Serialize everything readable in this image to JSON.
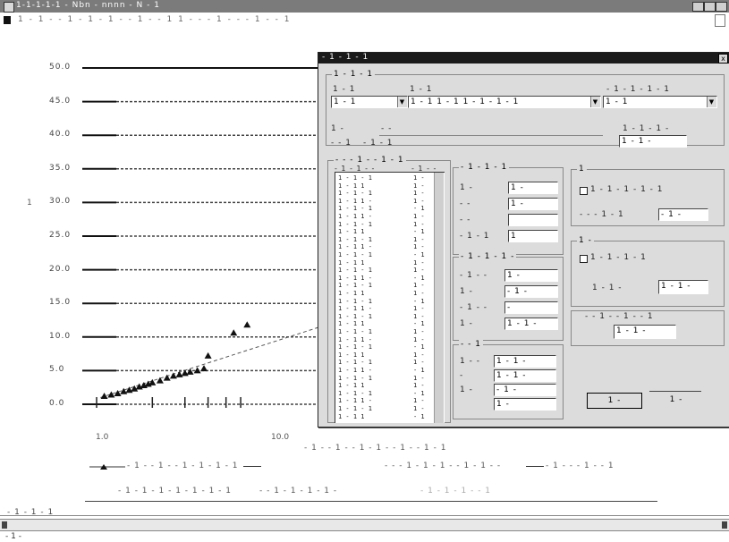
{
  "window": {
    "title": "1-1-1-1-1 - Nbn - nnnn - N - 1",
    "menu_text": "1 - 1 - - 1 - 1 - 1 - - 1 - - 1 1 - - - 1 - - - 1 - - 1",
    "controls": [
      "_",
      "□",
      "x"
    ]
  },
  "chart": {
    "y_ticks": [
      "50.0",
      "45.0",
      "40.0",
      "35.0",
      "30.0",
      "25.0",
      "20.0",
      "15.0",
      "10.0",
      "5.0",
      "0.0"
    ],
    "x_ticks": [
      "1.0",
      "10.0"
    ],
    "ylabel": "1",
    "xlabel": "- 1 - - 1 - - 1 - 1 - - 1 - - 1 - 1",
    "legend": [
      {
        "label": "- 1 - - 1 - - 1 - 1 - 1 - 1",
        "style": "marker-line"
      },
      {
        "label": "- - - 1 - 1 - 1 - - 1 - 1 - -",
        "style": "solid"
      },
      {
        "label": "- 1 - - - 1 - - 1",
        "style": "line"
      }
    ],
    "legend_row2": [
      "- 1 - 1 - 1 - 1 - 1 - 1 - 1",
      "- - 1 - 1 - 1 - 1 -",
      "- 1 - 1 - 1 - - 1"
    ]
  },
  "chart_data": {
    "type": "scatter",
    "x_axis": "log",
    "ylim": [
      0,
      50
    ],
    "y_ticks": [
      0,
      5,
      10,
      15,
      20,
      25,
      30,
      35,
      40,
      45,
      50
    ],
    "series": [
      {
        "style": "markers",
        "points": [
          [
            1.1,
            1.2
          ],
          [
            1.2,
            1.4
          ],
          [
            1.3,
            1.6
          ],
          [
            1.4,
            1.9
          ],
          [
            1.5,
            2.1
          ],
          [
            1.6,
            2.3
          ],
          [
            1.7,
            2.6
          ],
          [
            1.8,
            2.8
          ],
          [
            1.9,
            3.0
          ],
          [
            2.0,
            3.2
          ],
          [
            2.2,
            3.5
          ],
          [
            2.4,
            3.9
          ],
          [
            2.6,
            4.2
          ],
          [
            2.8,
            4.4
          ],
          [
            3.0,
            4.6
          ],
          [
            3.2,
            4.8
          ],
          [
            3.5,
            5.0
          ],
          [
            3.8,
            5.3
          ],
          [
            4.0,
            7.2
          ],
          [
            5.5,
            10.6
          ],
          [
            6.5,
            11.8
          ]
        ]
      }
    ]
  },
  "dialog": {
    "title": "- 1 - 1 - 1",
    "close": "x",
    "group_top_title": "1 - 1 - 1",
    "group_top_label1": "1 - 1",
    "combo1": {
      "value": "1 - 1"
    },
    "combo2_label": "1 - 1",
    "combo2": {
      "value": "1 - 1 1 - 1 1 - 1 - 1 - 1"
    },
    "combo3_label": "- 1 - 1 - 1 - 1",
    "combo3": {
      "value": "1 - 1"
    },
    "row2_label1": "1 -",
    "row2_val1": "- -",
    "row2_label2": "- - 1",
    "row2_val2": "- 1 - 1",
    "right_label": "1 - 1 - 1 -",
    "right_field": "1 - 1 -",
    "list_group_title": "- - - 1 - - 1 - 1",
    "list_header": [
      "- 1 - 1 - -",
      "- 1 - -"
    ],
    "list_rows": [
      [
        "1 - 1 - 1",
        "1 -"
      ],
      [
        "1 - 1 1",
        "1 -"
      ],
      [
        "1 - 1 - 1",
        "1 -"
      ],
      [
        "1 - 1 1 -",
        "1 -"
      ],
      [
        "1 - 1 - 1",
        "- 1"
      ],
      [
        "1 - 1 1 -",
        "1 -"
      ],
      [
        "1 - 1 - 1",
        "1 -"
      ],
      [
        "1 - 1 1",
        "- 1"
      ],
      [
        "1 - 1 - 1",
        "1 -"
      ],
      [
        "1 - 1 1 -",
        "1 -"
      ],
      [
        "1 - 1 - 1",
        "- 1"
      ],
      [
        "1 - 1 1",
        "1 -"
      ],
      [
        "1 - 1 - 1",
        "1 -"
      ],
      [
        "1 - 1 1 -",
        "- 1"
      ],
      [
        "1 - 1 - 1",
        "1 -"
      ],
      [
        "1 - 1 1",
        "1 -"
      ],
      [
        "1 - 1 - 1",
        "- 1"
      ],
      [
        "1 - 1 1 -",
        "1 -"
      ],
      [
        "1 - 1 - 1",
        "1 -"
      ],
      [
        "1 - 1 1",
        "- 1"
      ],
      [
        "1 - 1 - 1",
        "1 -"
      ],
      [
        "1 - 1 1 -",
        "1 -"
      ],
      [
        "1 - 1 - 1",
        "- 1"
      ],
      [
        "1 - 1 1",
        "1 -"
      ],
      [
        "1 - 1 - 1",
        "1 -"
      ],
      [
        "1 - 1 1 -",
        "- 1"
      ],
      [
        "1 - 1 - 1",
        "1 -"
      ],
      [
        "1 - 1 1",
        "1 -"
      ],
      [
        "1 - 1 - 1",
        "- 1"
      ],
      [
        "1 - 1 1 -",
        "1 -"
      ],
      [
        "1 - 1 - 1",
        "1 -"
      ],
      [
        "1 - 1 1",
        "- 1"
      ]
    ],
    "grp_mid_title": "- 1 - 1 - 1",
    "mid_labels": [
      "1 -",
      "- -",
      "- -",
      "- 1 - 1"
    ],
    "mid_values": [
      "1 -",
      "1 -",
      "",
      "1"
    ],
    "grp_mid2_title": "- 1 - 1 - 1 -",
    "mid2_labels": [
      "- 1 - -",
      "1 -",
      "- 1 - -",
      "1 -"
    ],
    "mid2_values": [
      "1 -",
      "- 1 -",
      "-",
      "1 - 1 -"
    ],
    "grp_mid3_title": "- - 1",
    "mid3_labels": [
      "1 - -",
      "-",
      "1 -"
    ],
    "mid3_values": [
      "1 - 1 -",
      "1 - 1 -",
      "- 1 -",
      "1 -"
    ],
    "grp_right1_title": "1",
    "right1_check_label": "1 - 1 - 1 - 1 - 1",
    "right1_label2": "- - - 1 - 1",
    "right1_field2": "- 1 -",
    "grp_right2_title": "1 -",
    "right2_check_label": "1 - 1 - 1 - 1",
    "right2_label2": "1 - 1 -",
    "right2_field2": "1 - 1 -",
    "right3_label": "- - 1 - - 1 - - 1",
    "right3_field": "1 - 1 -",
    "ok": "1 -",
    "cancel": "1 -"
  },
  "status": {
    "text": "- 1 - 1 - 1"
  },
  "bottom": {
    "text": "- 1 -"
  }
}
